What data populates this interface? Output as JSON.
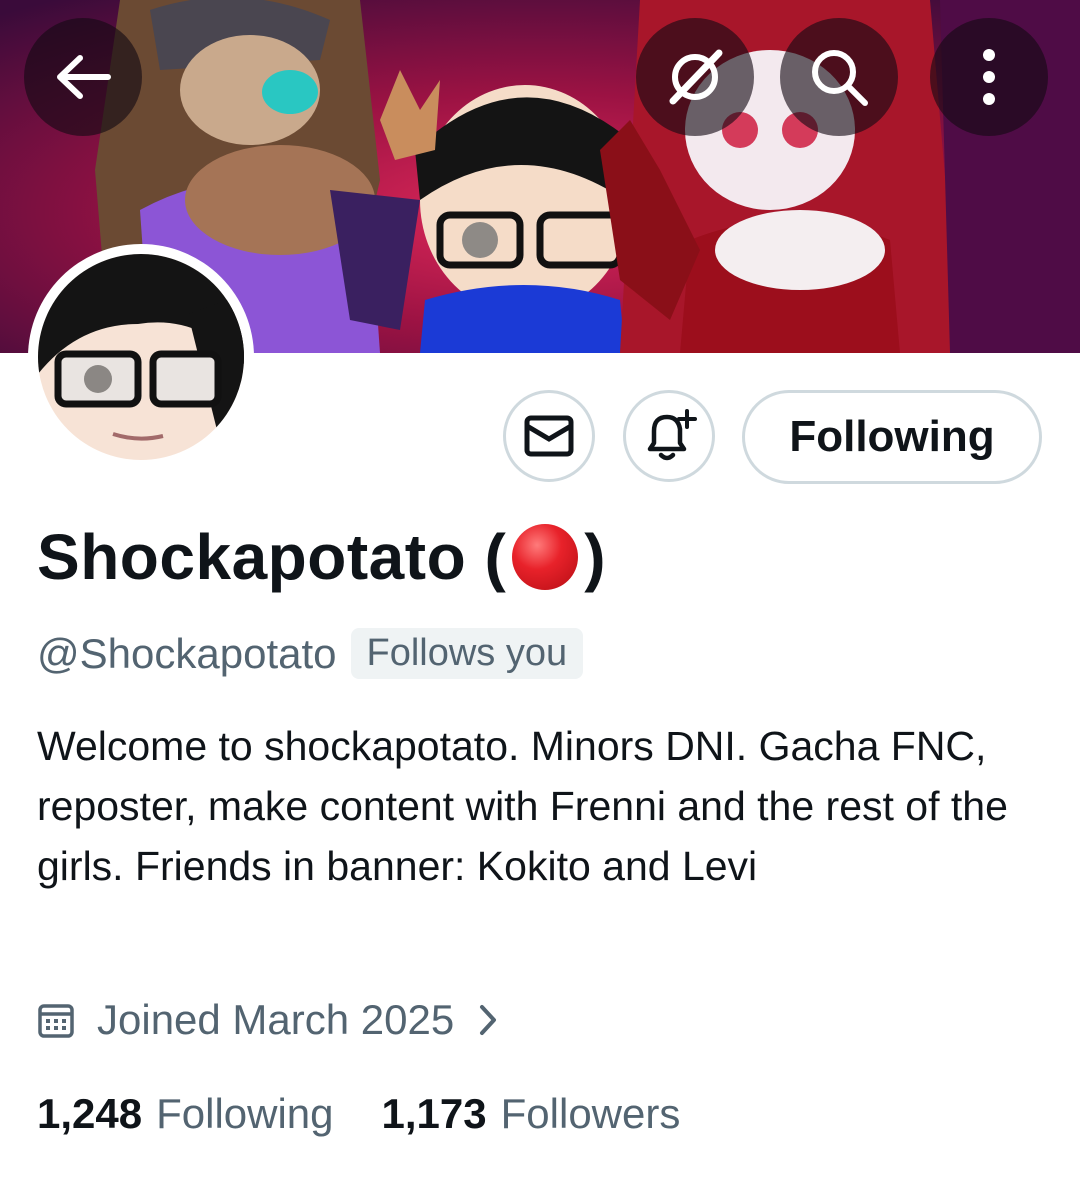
{
  "header": {
    "back_icon": "arrow-left-icon",
    "grok_icon": "grok-icon",
    "search_icon": "search-icon",
    "more_icon": "more-vertical-icon"
  },
  "banner": {
    "colors": {
      "bg_dark": "#3a0b3a",
      "bg_mid": "#b3163f",
      "bg_right": "#5a0f4f"
    }
  },
  "actions": {
    "message_icon": "mail-icon",
    "notify_icon": "bell-plus-icon",
    "follow_label": "Following"
  },
  "profile": {
    "name": "Shockapotato (",
    "name_suffix": ")",
    "name_emoji": "red-circle",
    "handle": "@Shockapotato",
    "follows_you": "Follows you",
    "bio": "Welcome to shockapotato. Minors DNI. Gacha FNC, reposter, make content with Frenni and the rest of the girls. Friends in banner: Kokito and Levi",
    "joined": "Joined March 2025",
    "joined_icon": "calendar-icon"
  },
  "stats": {
    "following_count": "1,248",
    "following_label": "Following",
    "followers_count": "1,173",
    "followers_label": "Followers"
  },
  "colors": {
    "text_primary": "#0f1419",
    "text_secondary": "#536471",
    "border": "#cfd9de",
    "badge_bg": "#eff3f4",
    "accent_red": "#e8222a"
  }
}
